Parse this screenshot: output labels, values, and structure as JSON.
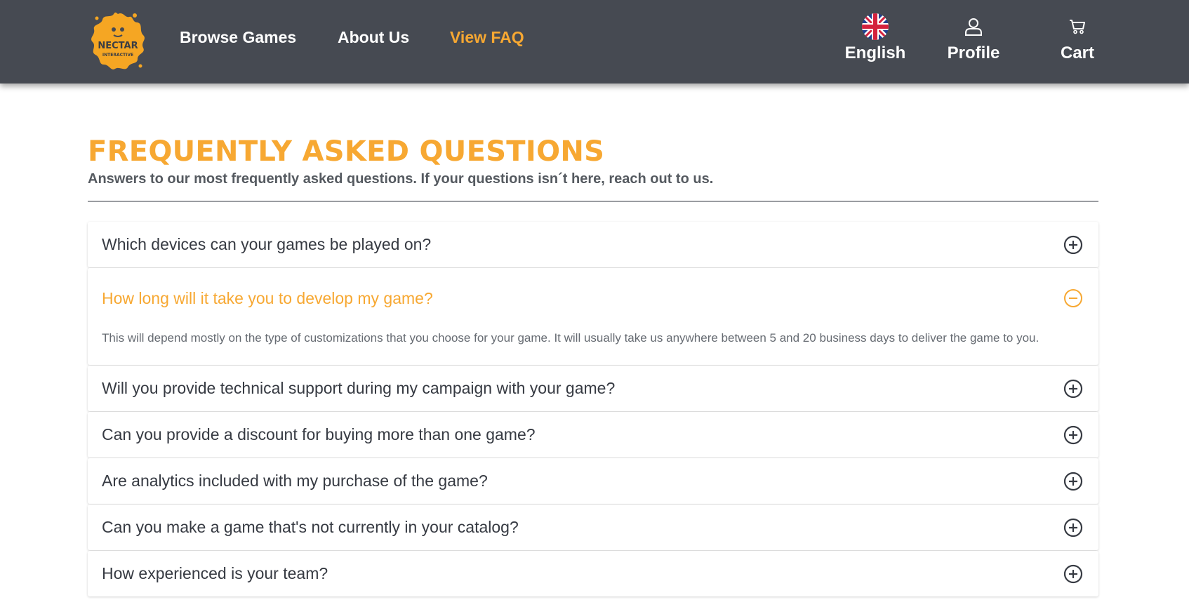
{
  "header": {
    "logo_text_main": "NECTAR",
    "logo_text_sub": "INTERACTIVE",
    "nav": [
      {
        "label": "Browse Games"
      },
      {
        "label": "About Us"
      },
      {
        "label": "View FAQ",
        "active": true
      }
    ],
    "language": {
      "label": "English",
      "icon": "uk-flag-icon"
    },
    "profile": {
      "label": "Profile",
      "icon": "user-icon"
    },
    "cart": {
      "label": "Cart",
      "icon": "cart-icon"
    }
  },
  "page": {
    "title": "FREQUENTLY ASKED QUESTIONS",
    "subtitle": "Answers to our most frequently asked questions. If your questions isn´t here, reach out to us."
  },
  "faq": [
    {
      "question": "Which devices can your games be played on?",
      "open": false
    },
    {
      "question": "How long will it take you to develop my game?",
      "open": true,
      "answer": "This will depend mostly on the type of customizations that you choose for your game. It will usually take us anywhere between 5 and 20 business days to deliver the game to you."
    },
    {
      "question": "Will you provide technical support during my campaign with your game?",
      "open": false
    },
    {
      "question": "Can you provide a discount for buying more than one game?",
      "open": false
    },
    {
      "question": "Are analytics included with my purchase of the game?",
      "open": false
    },
    {
      "question": "Can you make a game that's not currently in your catalog?",
      "open": false
    },
    {
      "question": "How experienced is your team?",
      "open": false
    }
  ],
  "colors": {
    "header_bg": "#464a52",
    "accent": "#f7a832",
    "text_dark": "#363a42",
    "text_muted": "#666b72"
  }
}
